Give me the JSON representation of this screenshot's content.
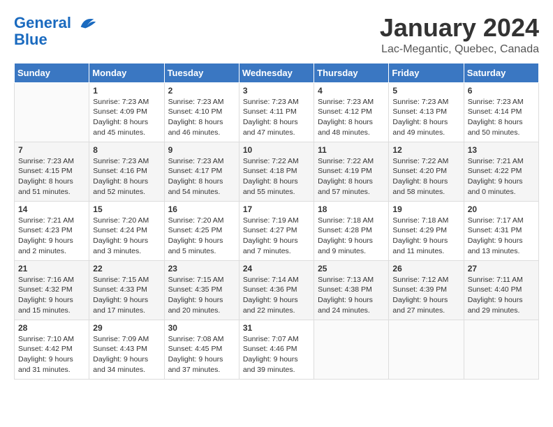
{
  "header": {
    "logo_line1": "General",
    "logo_line2": "Blue",
    "month": "January 2024",
    "location": "Lac-Megantic, Quebec, Canada"
  },
  "weekdays": [
    "Sunday",
    "Monday",
    "Tuesday",
    "Wednesday",
    "Thursday",
    "Friday",
    "Saturday"
  ],
  "weeks": [
    [
      {
        "day": "",
        "info": ""
      },
      {
        "day": "1",
        "info": "Sunrise: 7:23 AM\nSunset: 4:09 PM\nDaylight: 8 hours and 45 minutes."
      },
      {
        "day": "2",
        "info": "Sunrise: 7:23 AM\nSunset: 4:10 PM\nDaylight: 8 hours and 46 minutes."
      },
      {
        "day": "3",
        "info": "Sunrise: 7:23 AM\nSunset: 4:11 PM\nDaylight: 8 hours and 47 minutes."
      },
      {
        "day": "4",
        "info": "Sunrise: 7:23 AM\nSunset: 4:12 PM\nDaylight: 8 hours and 48 minutes."
      },
      {
        "day": "5",
        "info": "Sunrise: 7:23 AM\nSunset: 4:13 PM\nDaylight: 8 hours and 49 minutes."
      },
      {
        "day": "6",
        "info": "Sunrise: 7:23 AM\nSunset: 4:14 PM\nDaylight: 8 hours and 50 minutes."
      }
    ],
    [
      {
        "day": "7",
        "info": "Sunrise: 7:23 AM\nSunset: 4:15 PM\nDaylight: 8 hours and 51 minutes."
      },
      {
        "day": "8",
        "info": "Sunrise: 7:23 AM\nSunset: 4:16 PM\nDaylight: 8 hours and 52 minutes."
      },
      {
        "day": "9",
        "info": "Sunrise: 7:23 AM\nSunset: 4:17 PM\nDaylight: 8 hours and 54 minutes."
      },
      {
        "day": "10",
        "info": "Sunrise: 7:22 AM\nSunset: 4:18 PM\nDaylight: 8 hours and 55 minutes."
      },
      {
        "day": "11",
        "info": "Sunrise: 7:22 AM\nSunset: 4:19 PM\nDaylight: 8 hours and 57 minutes."
      },
      {
        "day": "12",
        "info": "Sunrise: 7:22 AM\nSunset: 4:20 PM\nDaylight: 8 hours and 58 minutes."
      },
      {
        "day": "13",
        "info": "Sunrise: 7:21 AM\nSunset: 4:22 PM\nDaylight: 9 hours and 0 minutes."
      }
    ],
    [
      {
        "day": "14",
        "info": "Sunrise: 7:21 AM\nSunset: 4:23 PM\nDaylight: 9 hours and 2 minutes."
      },
      {
        "day": "15",
        "info": "Sunrise: 7:20 AM\nSunset: 4:24 PM\nDaylight: 9 hours and 3 minutes."
      },
      {
        "day": "16",
        "info": "Sunrise: 7:20 AM\nSunset: 4:25 PM\nDaylight: 9 hours and 5 minutes."
      },
      {
        "day": "17",
        "info": "Sunrise: 7:19 AM\nSunset: 4:27 PM\nDaylight: 9 hours and 7 minutes."
      },
      {
        "day": "18",
        "info": "Sunrise: 7:18 AM\nSunset: 4:28 PM\nDaylight: 9 hours and 9 minutes."
      },
      {
        "day": "19",
        "info": "Sunrise: 7:18 AM\nSunset: 4:29 PM\nDaylight: 9 hours and 11 minutes."
      },
      {
        "day": "20",
        "info": "Sunrise: 7:17 AM\nSunset: 4:31 PM\nDaylight: 9 hours and 13 minutes."
      }
    ],
    [
      {
        "day": "21",
        "info": "Sunrise: 7:16 AM\nSunset: 4:32 PM\nDaylight: 9 hours and 15 minutes."
      },
      {
        "day": "22",
        "info": "Sunrise: 7:15 AM\nSunset: 4:33 PM\nDaylight: 9 hours and 17 minutes."
      },
      {
        "day": "23",
        "info": "Sunrise: 7:15 AM\nSunset: 4:35 PM\nDaylight: 9 hours and 20 minutes."
      },
      {
        "day": "24",
        "info": "Sunrise: 7:14 AM\nSunset: 4:36 PM\nDaylight: 9 hours and 22 minutes."
      },
      {
        "day": "25",
        "info": "Sunrise: 7:13 AM\nSunset: 4:38 PM\nDaylight: 9 hours and 24 minutes."
      },
      {
        "day": "26",
        "info": "Sunrise: 7:12 AM\nSunset: 4:39 PM\nDaylight: 9 hours and 27 minutes."
      },
      {
        "day": "27",
        "info": "Sunrise: 7:11 AM\nSunset: 4:40 PM\nDaylight: 9 hours and 29 minutes."
      }
    ],
    [
      {
        "day": "28",
        "info": "Sunrise: 7:10 AM\nSunset: 4:42 PM\nDaylight: 9 hours and 31 minutes."
      },
      {
        "day": "29",
        "info": "Sunrise: 7:09 AM\nSunset: 4:43 PM\nDaylight: 9 hours and 34 minutes."
      },
      {
        "day": "30",
        "info": "Sunrise: 7:08 AM\nSunset: 4:45 PM\nDaylight: 9 hours and 37 minutes."
      },
      {
        "day": "31",
        "info": "Sunrise: 7:07 AM\nSunset: 4:46 PM\nDaylight: 9 hours and 39 minutes."
      },
      {
        "day": "",
        "info": ""
      },
      {
        "day": "",
        "info": ""
      },
      {
        "day": "",
        "info": ""
      }
    ]
  ]
}
